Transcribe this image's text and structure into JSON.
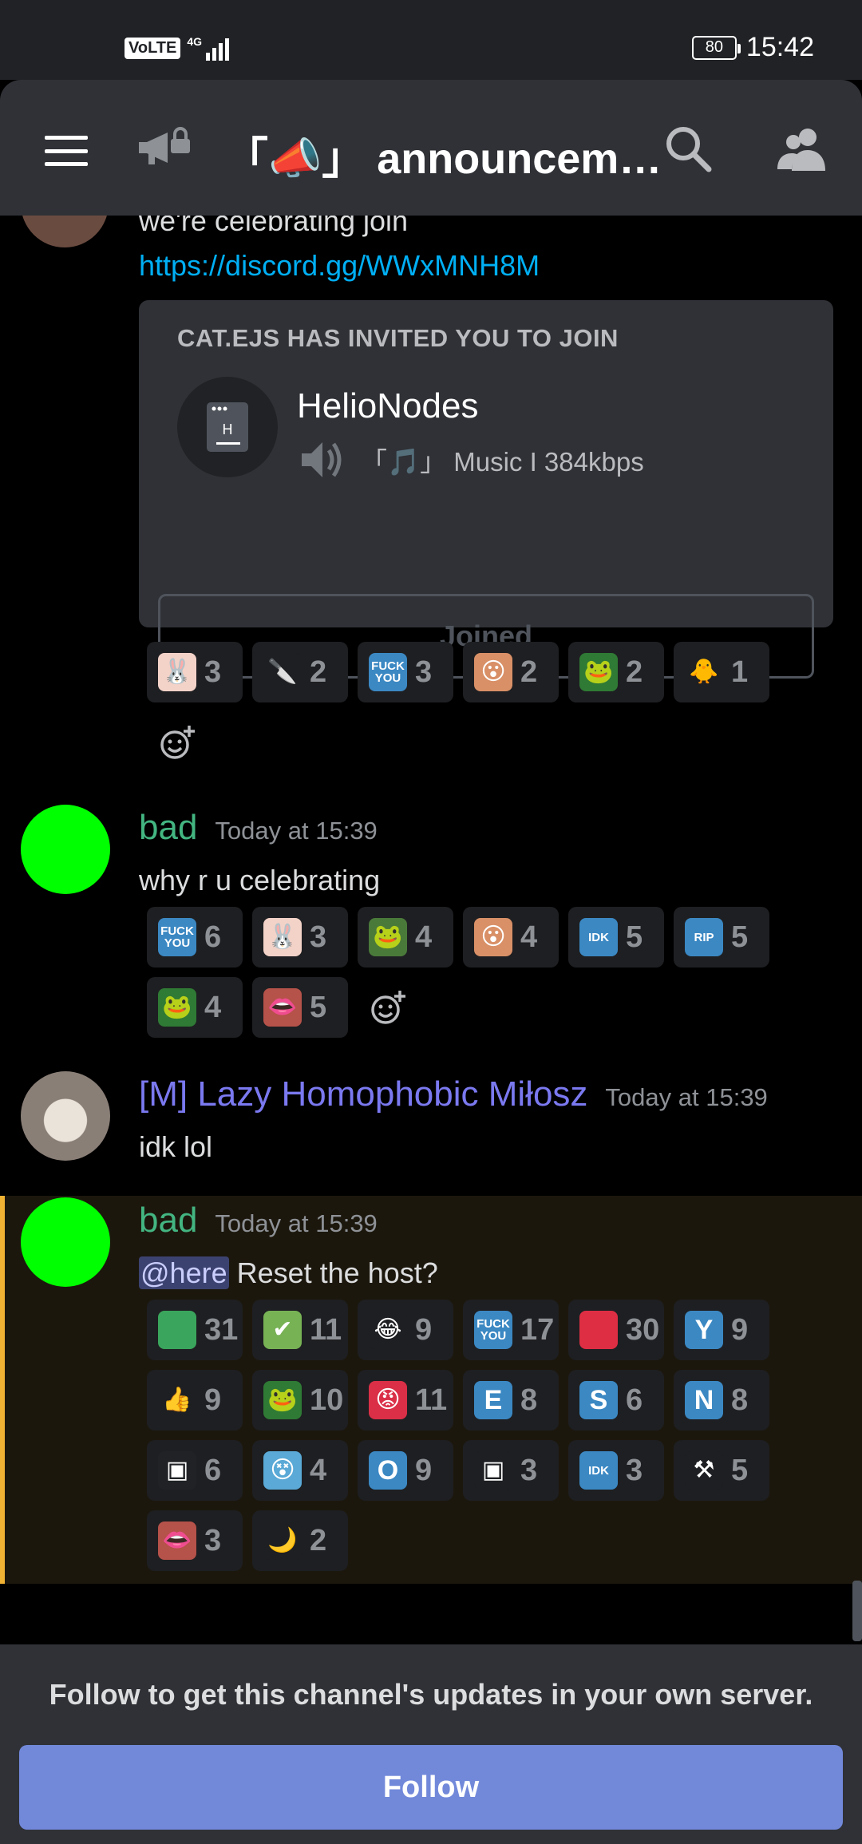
{
  "status_bar": {
    "network_badge": "VoLTE",
    "network_type": "4G",
    "battery": "80",
    "time": "15:42"
  },
  "header": {
    "channel_title": "「📣」 announcem…",
    "icons": [
      "menu-icon",
      "announcement-locked-icon",
      "search-icon",
      "members-icon"
    ]
  },
  "messages": [
    {
      "text": "we're celebrating join",
      "link": "https://discord.gg/WWxMNH8M",
      "invite": {
        "heading": "CAT.EJS HAS INVITED YOU TO JOIN",
        "server_name": "HelioNodes",
        "voice_channel": "「🎵」 Music I 384kbps",
        "button": "Joined"
      },
      "reactions": [
        {
          "emoji": "bunny",
          "count": "3"
        },
        {
          "emoji": "knife-cat",
          "count": "2"
        },
        {
          "emoji": "fuck-you",
          "label": "FUCK YOU",
          "count": "3"
        },
        {
          "emoji": "face",
          "count": "2"
        },
        {
          "emoji": "pepe",
          "count": "2"
        },
        {
          "emoji": "duck",
          "count": "1"
        }
      ]
    },
    {
      "author": "bad",
      "author_color": "#43b581",
      "timestamp": "Today at 15:39",
      "text": "why r u celebrating",
      "reactions": [
        {
          "emoji": "fuck-you",
          "label": "FUCK YOU",
          "count": "6"
        },
        {
          "emoji": "bunny",
          "count": "3"
        },
        {
          "emoji": "pepe-sign",
          "count": "4"
        },
        {
          "emoji": "face",
          "count": "4"
        },
        {
          "emoji": "idk",
          "label": "IDK",
          "count": "5"
        },
        {
          "emoji": "rip",
          "label": "RIP",
          "count": "5"
        },
        {
          "emoji": "pepe",
          "count": "4"
        },
        {
          "emoji": "mouth",
          "count": "5"
        }
      ]
    },
    {
      "author": "[M] Lazy Homophobic Miłosz",
      "author_color": "#7b79f0",
      "timestamp": "Today at 15:39",
      "text": "idk lol"
    },
    {
      "author": "bad",
      "author_color": "#43b581",
      "timestamp": "Today at 15:39",
      "mention": "@here",
      "text": " Reset the host?",
      "reactions": [
        {
          "emoji": "green-square",
          "count": "31"
        },
        {
          "emoji": "check",
          "count": "11"
        },
        {
          "emoji": "joy",
          "count": "9"
        },
        {
          "emoji": "fuck-you",
          "label": "FUCK YOU",
          "count": "17"
        },
        {
          "emoji": "red-square",
          "count": "30"
        },
        {
          "emoji": "letter-y",
          "label": "Y",
          "count": "9"
        },
        {
          "emoji": "thumbs-up",
          "count": "9"
        },
        {
          "emoji": "pepe",
          "count": "10"
        },
        {
          "emoji": "cursing",
          "count": "11"
        },
        {
          "emoji": "letter-e",
          "label": "E",
          "count": "8"
        },
        {
          "emoji": "letter-s",
          "label": "S",
          "count": "6"
        },
        {
          "emoji": "letter-n",
          "label": "N",
          "count": "8"
        },
        {
          "emoji": "helio",
          "count": "6"
        },
        {
          "emoji": "anime",
          "count": "4"
        },
        {
          "emoji": "letter-o",
          "label": "O",
          "count": "9"
        },
        {
          "emoji": "helio-h",
          "count": "3"
        },
        {
          "emoji": "idk",
          "label": "IDK",
          "count": "3"
        },
        {
          "emoji": "hammer",
          "count": "5"
        },
        {
          "emoji": "mouth",
          "count": "3"
        },
        {
          "emoji": "duck-moon",
          "count": "2"
        }
      ]
    }
  ],
  "follow_bar": {
    "text": "Follow to get this channel's updates in your own server.",
    "button": "Follow"
  },
  "colors": {
    "accent": "#7289da",
    "link": "#00aff4",
    "highlight_border": "#f0b232"
  }
}
